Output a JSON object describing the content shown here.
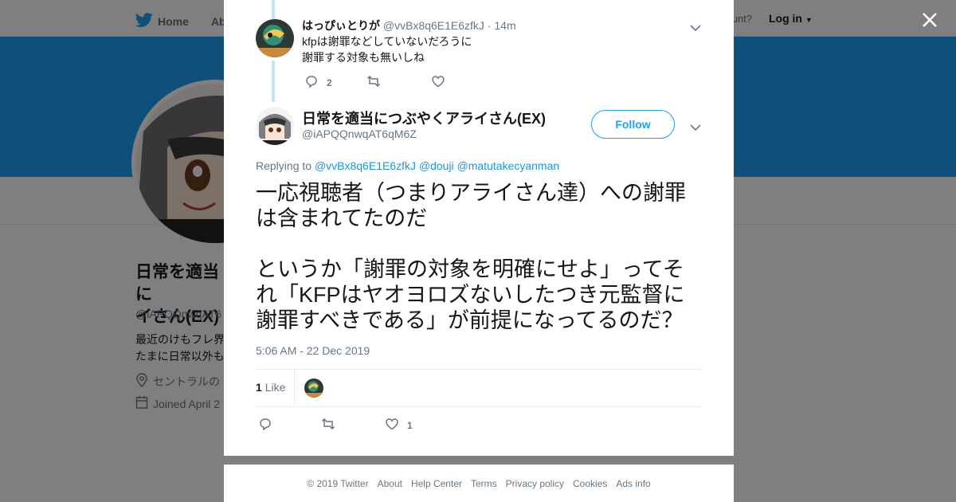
{
  "topbar": {
    "home_label": "Home",
    "about_label": "Abo",
    "account_prompt": "count?",
    "login_label": "Log in"
  },
  "profile": {
    "name_line1": "日常を適当に",
    "name_line2": "イさん(EX)",
    "handle": "@iAPQQnwqAT6",
    "bio_line1": "最近のけもフレ界",
    "bio_line2": "たまに日常以外も",
    "location": "セントラルの",
    "joined": "Joined April 2"
  },
  "parent_tweet": {
    "name": "はっぴぃとりが",
    "handle": "@vvBx8q6E1E6zfkJ",
    "separator": "·",
    "time": "14m",
    "text_line1": "kfpは謝罪などしていないだろうに",
    "text_line2": "謝罪する対象も無いしね",
    "reply_count": "2",
    "retweet_count": "",
    "like_count": ""
  },
  "main_tweet": {
    "name": "日常を適当につぶやくアライさん(EX)",
    "handle": "@iAPQQnwqAT6qM6Z",
    "follow_label": "Follow",
    "replying_prefix": "Replying to",
    "replying_1": "@vvBx8q6E1E6zfkJ",
    "replying_2": "@douji",
    "replying_3": "@matutakecyanman",
    "body_line1": "一応視聴者（つまりアライさん達）への謝罪",
    "body_line2": "は含まれてたのだ",
    "body_line3": "というか「謝罪の対象を明確にせよ」ってそ",
    "body_line4": "れ「KFPはヤオヨロズないしたつき元監督に",
    "body_line5": "謝罪すべきである」が前提になってるのだ？",
    "timestamp": "5:06 AM - 22 Dec 2019",
    "likes_number": "1",
    "likes_label": "Like",
    "action_like_count": "1"
  },
  "footer": {
    "copyright": "© 2019 Twitter",
    "about": "About",
    "help": "Help Center",
    "terms": "Terms",
    "privacy": "Privacy policy",
    "cookies": "Cookies",
    "ads": "Ads info"
  },
  "colors": {
    "twitter_blue": "#1da1f2",
    "link_blue": "#1b95e0",
    "muted_text": "#657786",
    "thread_line": "#c4e3f5"
  },
  "icons": [
    "twitter-bird-icon",
    "close-icon",
    "chevron-down-icon",
    "reply-icon",
    "retweet-icon",
    "heart-icon",
    "location-pin-icon",
    "calendar-icon"
  ]
}
